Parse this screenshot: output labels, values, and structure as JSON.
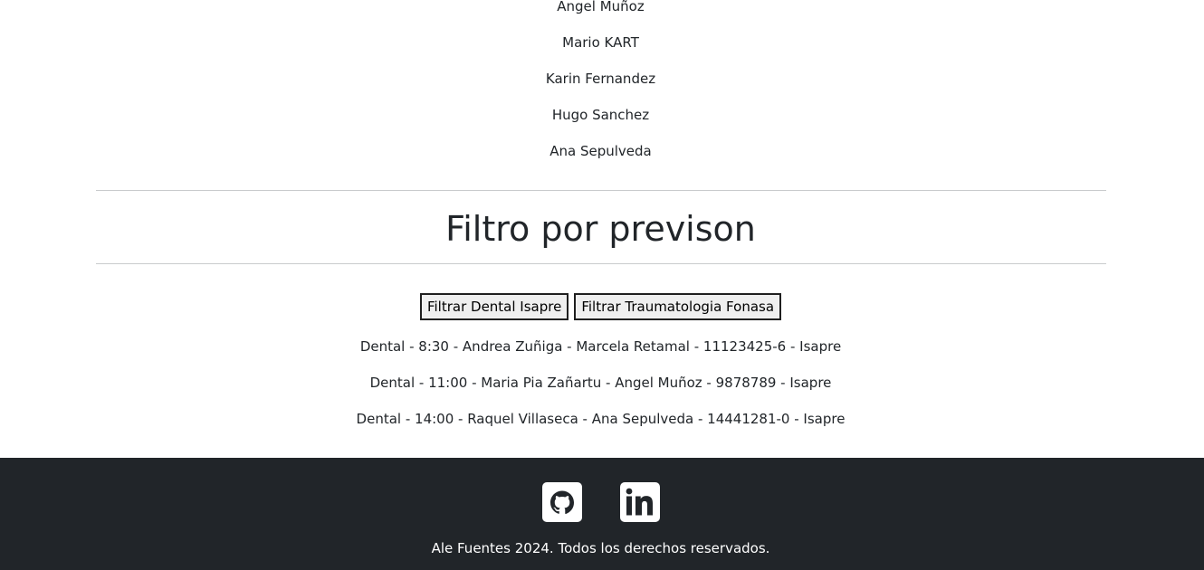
{
  "patients": [
    "Angel Muñoz",
    "Mario KART",
    "Karin Fernandez",
    "Hugo Sanchez",
    "Ana Sepulveda"
  ],
  "filter_section": {
    "title": "Filtro por previson",
    "buttons": {
      "dental_isapre": "Filtrar Dental Isapre",
      "traumatologia_fonasa": "Filtrar Traumatologia Fonasa"
    },
    "results": [
      "Dental - 8:30 - Andrea Zuñiga - Marcela Retamal - 11123425-6 - Isapre",
      "Dental - 11:00 - Maria Pia Zañartu - Angel Muñoz - 9878789 - Isapre",
      "Dental - 14:00 - Raquel Villaseca - Ana Sepulveda - 14441281-0 - Isapre"
    ]
  },
  "footer": {
    "icons": [
      "github-icon",
      "linkedin-icon"
    ],
    "copyright": "Ale Fuentes 2024. Todos los derechos reservados.",
    "background_color": "#212529",
    "text_color": "#ffffff"
  }
}
